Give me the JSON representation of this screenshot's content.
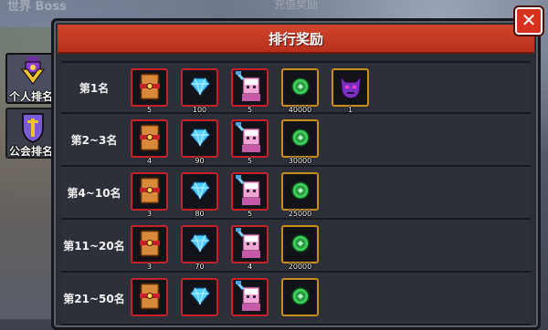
{
  "background": {
    "top_left_text": "世界 Boss",
    "top_center_text": "充值奖励"
  },
  "side_tabs": [
    {
      "label": "个人排名",
      "icon": "person-rank-icon",
      "active": true
    },
    {
      "label": "公会排名",
      "icon": "guild-shield-icon",
      "active": false
    }
  ],
  "panel": {
    "title": "排行奖励",
    "close_label": "✕"
  },
  "colors": {
    "title_red": "#c93a24",
    "panel_bg": "#2b2d36",
    "border_red": "#c7222a",
    "border_gold": "#c98f1a"
  },
  "rows": [
    {
      "rank": "第1名",
      "items": [
        {
          "icon": "treasure-chest-icon",
          "qty": "5",
          "border": "red"
        },
        {
          "icon": "diamond-icon",
          "qty": "100",
          "border": "red"
        },
        {
          "icon": "pink-hero-icon",
          "qty": "5",
          "border": "red"
        },
        {
          "icon": "gold-coin-icon",
          "qty": "40000",
          "border": "gold"
        },
        {
          "icon": "purple-demon-icon",
          "qty": "1",
          "border": "gold"
        }
      ]
    },
    {
      "rank": "第2~3名",
      "items": [
        {
          "icon": "treasure-chest-icon",
          "qty": "4",
          "border": "red"
        },
        {
          "icon": "diamond-icon",
          "qty": "90",
          "border": "red"
        },
        {
          "icon": "pink-hero-icon",
          "qty": "5",
          "border": "red"
        },
        {
          "icon": "gold-coin-icon",
          "qty": "30000",
          "border": "gold"
        }
      ]
    },
    {
      "rank": "第4~10名",
      "items": [
        {
          "icon": "treasure-chest-icon",
          "qty": "3",
          "border": "red"
        },
        {
          "icon": "diamond-icon",
          "qty": "80",
          "border": "red"
        },
        {
          "icon": "pink-hero-icon",
          "qty": "5",
          "border": "red"
        },
        {
          "icon": "gold-coin-icon",
          "qty": "25000",
          "border": "gold"
        }
      ]
    },
    {
      "rank": "第11~20名",
      "items": [
        {
          "icon": "treasure-chest-icon",
          "qty": "3",
          "border": "red"
        },
        {
          "icon": "diamond-icon",
          "qty": "70",
          "border": "red"
        },
        {
          "icon": "pink-hero-icon",
          "qty": "4",
          "border": "red"
        },
        {
          "icon": "gold-coin-icon",
          "qty": "20000",
          "border": "gold"
        }
      ]
    },
    {
      "rank": "第21~50名",
      "items": [
        {
          "icon": "treasure-chest-icon",
          "qty": "",
          "border": "red"
        },
        {
          "icon": "diamond-icon",
          "qty": "",
          "border": "red"
        },
        {
          "icon": "pink-hero-icon",
          "qty": "",
          "border": "red"
        },
        {
          "icon": "gold-coin-icon",
          "qty": "",
          "border": "gold"
        }
      ]
    }
  ]
}
